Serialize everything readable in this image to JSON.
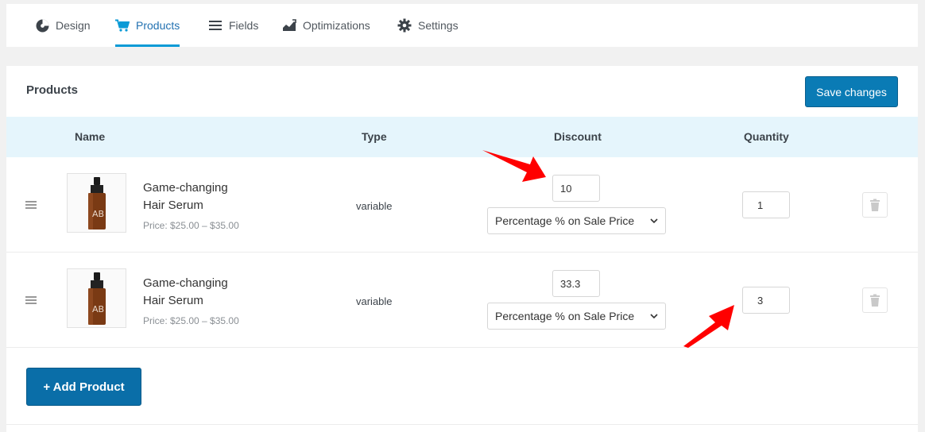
{
  "tabs": [
    {
      "label": "Design",
      "icon": "palette-icon",
      "active": false
    },
    {
      "label": "Products",
      "icon": "cart-icon",
      "active": true
    },
    {
      "label": "Fields",
      "icon": "list-icon",
      "active": false
    },
    {
      "label": "Optimizations",
      "icon": "chart-icon",
      "active": false
    },
    {
      "label": "Settings",
      "icon": "gear-icon",
      "active": false
    }
  ],
  "panel": {
    "title": "Products",
    "save_label": "Save changes"
  },
  "table": {
    "headers": {
      "name": "Name",
      "type": "Type",
      "discount": "Discount",
      "quantity": "Quantity"
    },
    "rows": [
      {
        "name_line1": "Game-changing",
        "name_line2": "Hair Serum",
        "price": "Price: $25.00 – $35.00",
        "type": "variable",
        "discount_value": "10",
        "discount_type": "Percentage % on Sale Price",
        "quantity": "1"
      },
      {
        "name_line1": "Game-changing",
        "name_line2": "Hair Serum",
        "price": "Price: $25.00 – $35.00",
        "type": "variable",
        "discount_value": "33.3",
        "discount_type": "Percentage % on Sale Price",
        "quantity": "3"
      }
    ]
  },
  "add_product_label": "+ Add Product",
  "colors": {
    "accent": "#0a9ad6",
    "primary_button": "#0a7bb5",
    "header_bg": "#e5f5fc",
    "annotation_arrow": "#ff0000"
  }
}
